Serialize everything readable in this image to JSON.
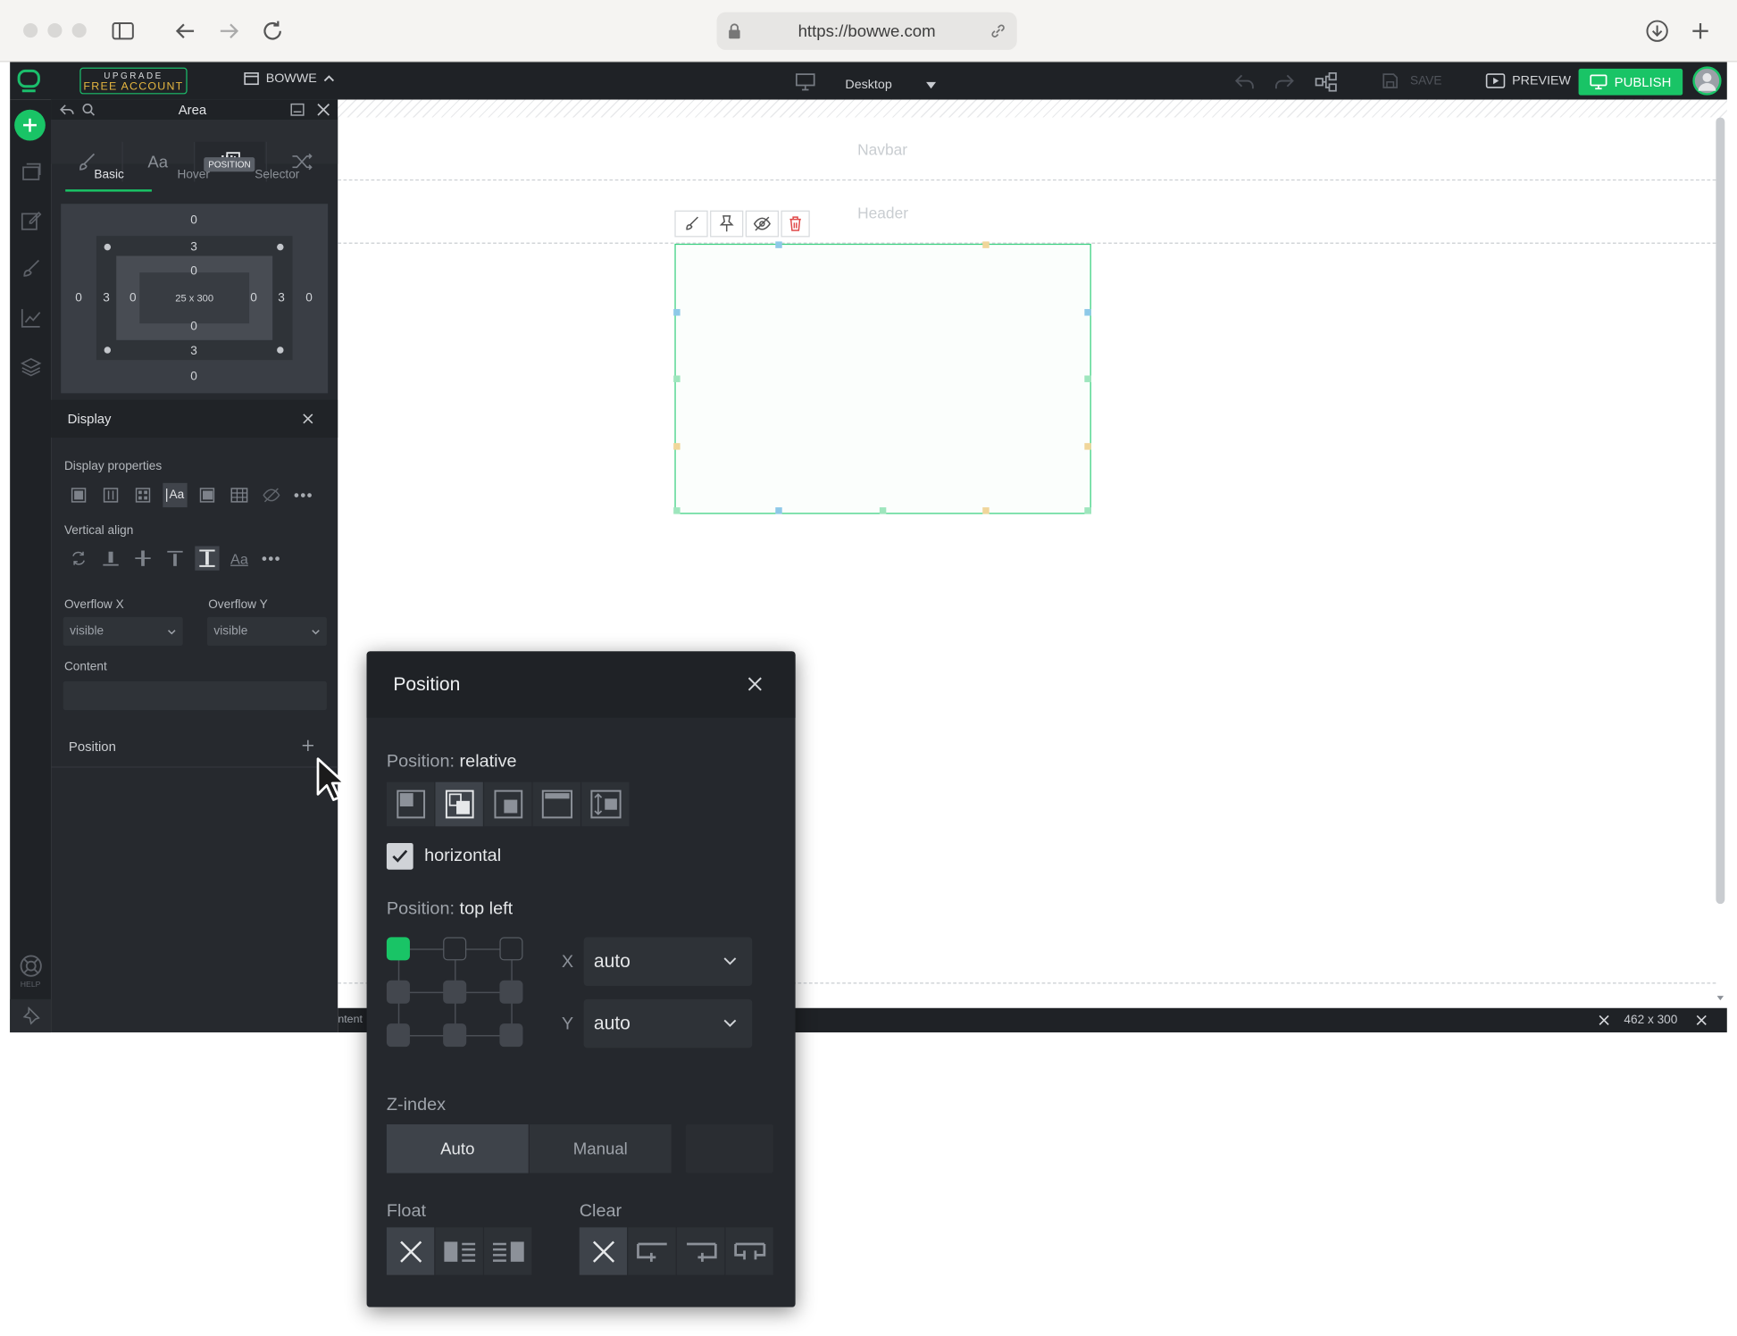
{
  "browser": {
    "url": "https://bowwe.com"
  },
  "topbar": {
    "upgrade_line1": "UPGRADE",
    "upgrade_line2": "FREE ACCOUNT",
    "site_name": "BOWWE",
    "device": "Desktop",
    "save": "SAVE",
    "preview": "PREVIEW",
    "publish": "PUBLISH"
  },
  "rail": {
    "help": "HELP"
  },
  "panel": {
    "title": "Area",
    "tooltip": "POSITION",
    "subtabs": [
      "Basic",
      "Hover",
      "Selector"
    ],
    "boxmodel": {
      "margin_top": "0",
      "margin_bottom": "0",
      "margin_left": "0",
      "margin_right": "0",
      "border_top": "3",
      "border_bottom": "3",
      "border_left": "3",
      "border_right": "3",
      "padding_top": "0",
      "padding_bottom": "0",
      "padding_left": "0",
      "padding_right": "0",
      "size": "25 x 300"
    },
    "display_section": "Display",
    "display_properties": "Display properties",
    "vertical_align": "Vertical align",
    "overflow_x_label": "Overflow X",
    "overflow_y_label": "Overflow Y",
    "overflow_x": "visible",
    "overflow_y": "visible",
    "content_label": "Content",
    "position_section": "Position"
  },
  "canvas": {
    "navbar": "Navbar",
    "header": "Header",
    "status_left": "ntent",
    "status_size": "462 x 300"
  },
  "popup": {
    "title": "Position",
    "position_label": "Position:",
    "position_value": "relative",
    "horizontal": "horizontal",
    "horizontal_checked": true,
    "anchor_label": "Position:",
    "anchor_value": "top left",
    "x_label": "X",
    "x_value": "auto",
    "y_label": "Y",
    "y_value": "auto",
    "zindex_label": "Z-index",
    "zindex_auto": "Auto",
    "zindex_manual": "Manual",
    "float_label": "Float",
    "clear_label": "Clear"
  },
  "colors": {
    "accent": "#19c466",
    "upgrade_text": "#e5b640",
    "delete": "#e04848"
  }
}
